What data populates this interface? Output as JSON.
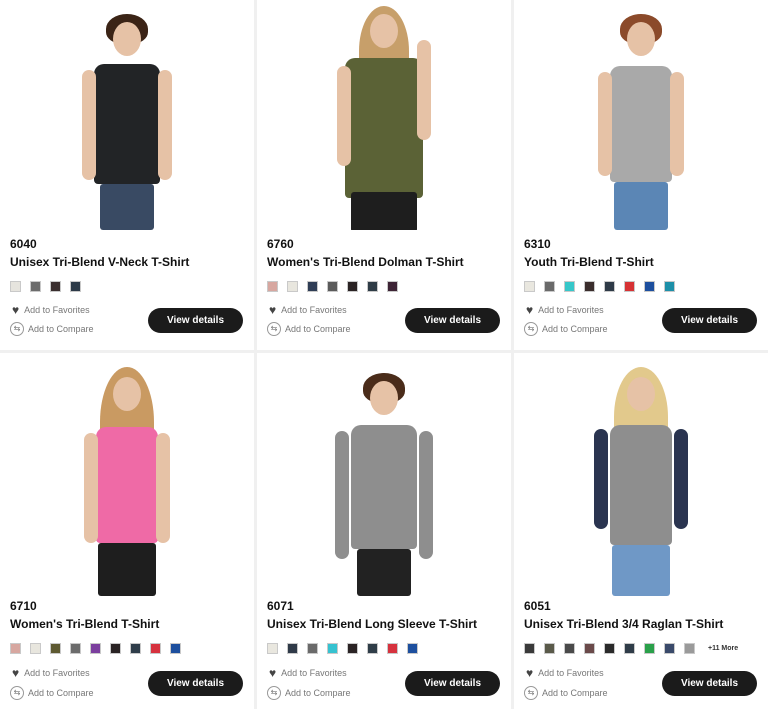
{
  "products": [
    {
      "sku": "6040",
      "title": "Unisex Tri-Blend V-Neck T-Shirt",
      "swatches": [
        "#e6e4de",
        "#6c6c6c",
        "#3a2f2f",
        "#2d3a48"
      ],
      "more_label": "",
      "favorites_label": "Add to Favorites",
      "compare_label": "Add to Compare",
      "button_label": "View details",
      "shirt_color": "#222426",
      "pants_color": "#394a63",
      "hair_color": "#3b2416"
    },
    {
      "sku": "6760",
      "title": "Women's Tri-Blend Dolman T-Shirt",
      "swatches": [
        "#d7a7a0",
        "#e8e6de",
        "#2f3d55",
        "#5b5b5b",
        "#2a2324",
        "#2f3c46",
        "#3d2435"
      ],
      "more_label": "",
      "favorites_label": "Add to Favorites",
      "compare_label": "Add to Compare",
      "button_label": "View details",
      "shirt_color": "#5b6236",
      "pants_color": "#1e1e1e",
      "hair_color": "#c79f6a"
    },
    {
      "sku": "6310",
      "title": "Youth Tri-Blend T-Shirt",
      "swatches": [
        "#e9e7df",
        "#6a6a6a",
        "#36c7c9",
        "#3a2d2c",
        "#2e3a47",
        "#d63234",
        "#1d4f9e",
        "#1d8fa8"
      ],
      "more_label": "",
      "favorites_label": "Add to Favorites",
      "compare_label": "Add to Compare",
      "button_label": "View details",
      "shirt_color": "#a9a9a9",
      "pants_color": "#5b86b5",
      "hair_color": "#8b4a2a"
    },
    {
      "sku": "6710",
      "title": "Women's Tri-Blend T-Shirt",
      "swatches": [
        "#d7a7a0",
        "#e8e6de",
        "#5e5a32",
        "#6c6c6c",
        "#7b3f9e",
        "#2a2324",
        "#2f3d4a",
        "#d6323e",
        "#1d4f9e"
      ],
      "more_label": "",
      "favorites_label": "Add to Favorites",
      "compare_label": "Add to Compare",
      "button_label": "View details",
      "shirt_color": "#ef6aa6",
      "pants_color": "#1e1e1e",
      "hair_color": "#c99a62"
    },
    {
      "sku": "6071",
      "title": "Unisex Tri-Blend Long Sleeve T-Shirt",
      "swatches": [
        "#e9e7df",
        "#2f3a48",
        "#6a6a6a",
        "#36c2d0",
        "#2a2324",
        "#2f3d48",
        "#d6323e",
        "#1d4f9e"
      ],
      "more_label": "",
      "favorites_label": "Add to Favorites",
      "compare_label": "Add to Compare",
      "button_label": "View details",
      "shirt_color": "#8e8e8e",
      "pants_color": "#222222",
      "hair_color": "#4a2c1a"
    },
    {
      "sku": "6051",
      "title": "Unisex Tri-Blend 3/4 Raglan T-Shirt",
      "swatches": [
        "#3a3a3a",
        "#5a5a4a",
        "#4a4a4a",
        "#6a4a4a",
        "#2a2a2a",
        "#2f3c48",
        "#2aa04a",
        "#3a4a6a",
        "#9a9a9a"
      ],
      "more_label": "+11 More",
      "favorites_label": "Add to Favorites",
      "compare_label": "Add to Compare",
      "button_label": "View details",
      "shirt_color": "#8e8e8e",
      "pants_color": "#6f98c6",
      "hair_color": "#e2c98c"
    }
  ]
}
